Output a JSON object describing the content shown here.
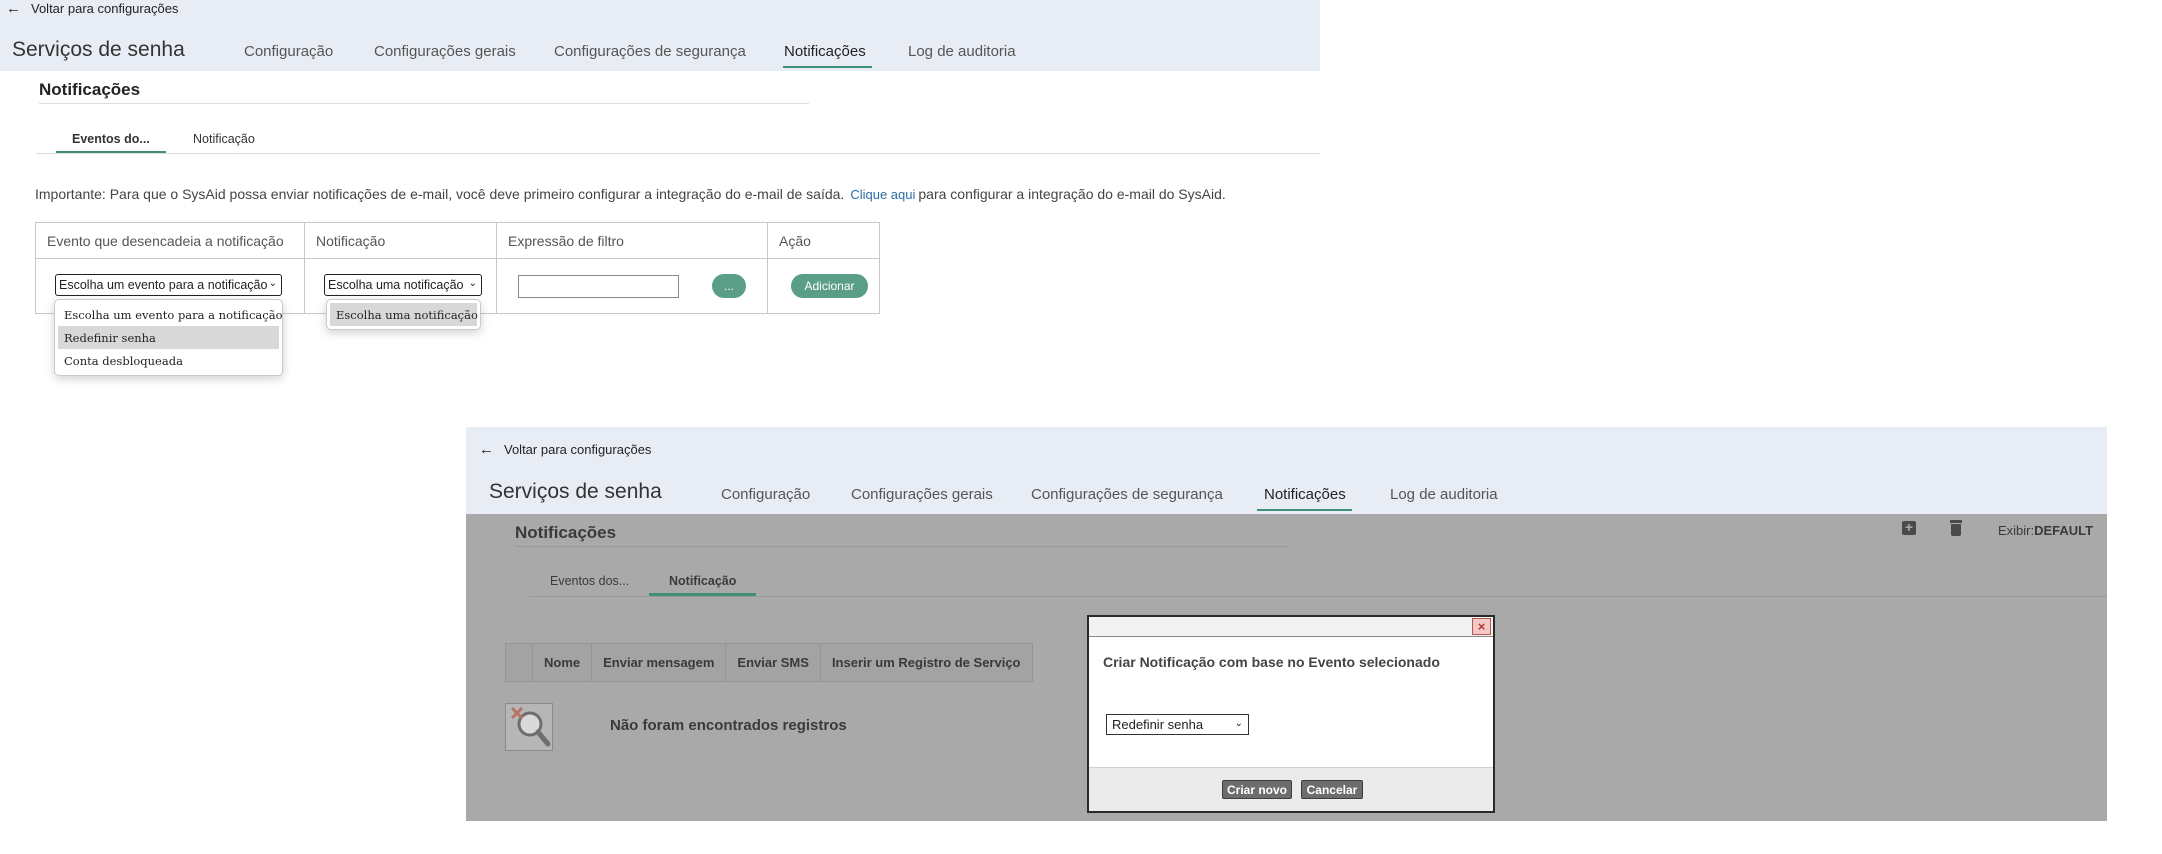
{
  "panel1": {
    "back_label": "Voltar para configurações",
    "app_title": "Serviços de senha",
    "nav": [
      "Configuração",
      "Configurações gerais",
      "Configurações de segurança",
      "Notificações",
      "Log de auditoria"
    ],
    "nav_active": "Notificações",
    "section_title": "Notificações",
    "subtabs": [
      "Eventos do...",
      "Notificação"
    ],
    "subtab_active": "Eventos do...",
    "info": {
      "before": "Importante: Para que o SysAid possa enviar notificações de e-mail, você deve primeiro configurar a integração do e-mail de saída.",
      "link": "Clique aqui",
      "after": "para configurar a integração do e-mail do SysAid."
    },
    "table": {
      "headers": [
        "Evento que desencadeia a notificação",
        "Notificação",
        "Expressão de filtro",
        "Ação"
      ],
      "event_select_value": "Escolha um evento para a notificação",
      "notification_select_value": "Escolha uma notificação",
      "filter_button": "...",
      "add_button": "Adicionar"
    },
    "event_dropdown": [
      "Escolha um evento para a notificação",
      "Redefinir senha",
      "Conta desbloqueada"
    ],
    "event_dropdown_highlighted": "Redefinir senha",
    "notification_dropdown": [
      "Escolha uma notificação"
    ]
  },
  "panel2": {
    "back_label": "Voltar para configurações",
    "app_title": "Serviços de senha",
    "nav": [
      "Configuração",
      "Configurações gerais",
      "Configurações de segurança",
      "Notificações",
      "Log de auditoria"
    ],
    "nav_active": "Notificações",
    "section_title": "Notificações",
    "view_label": "Exibir:",
    "view_value": "DEFAULT",
    "subtabs": [
      "Eventos dos...",
      "Notificação"
    ],
    "subtab_active": "Notificação",
    "grid_headers": [
      "Nome",
      "Enviar mensagem",
      "Enviar SMS",
      "Inserir um Registro de Serviço"
    ],
    "no_records": "Não foram encontrados registros",
    "dialog": {
      "message": "Criar Notificação com base no Evento selecionado",
      "select_value": "Redefinir senha",
      "create_button": "Criar novo",
      "cancel_button": "Cancelar"
    }
  },
  "colors": {
    "header_bg": "#e8edf5",
    "accent": "#3f8f78",
    "pill": "#5b9e87",
    "overlay": "#a9a9a9"
  }
}
